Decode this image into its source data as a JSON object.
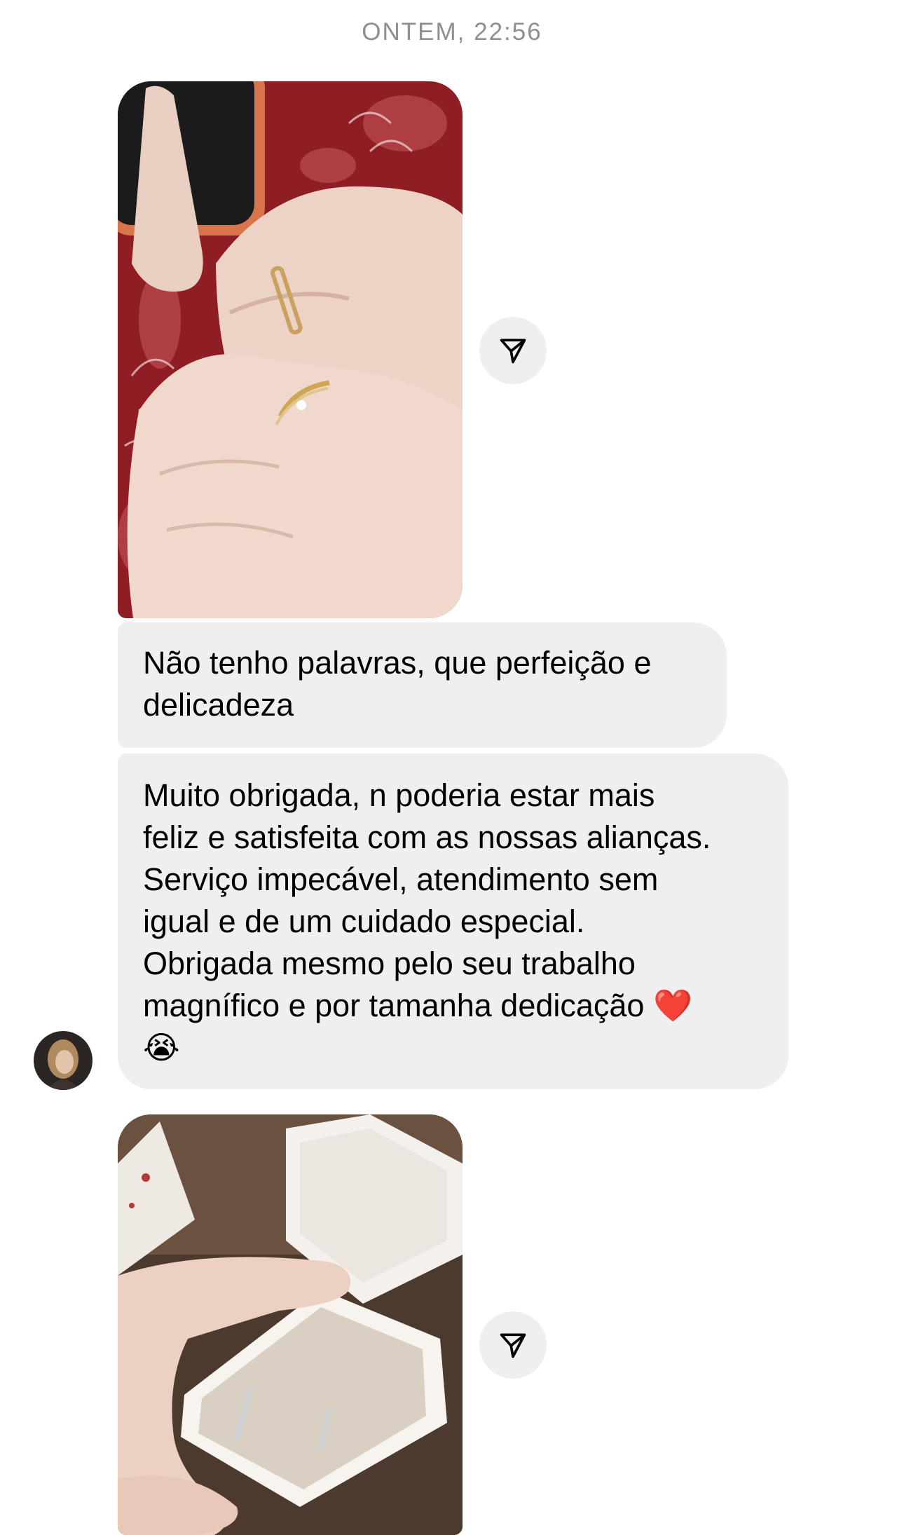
{
  "conversation": {
    "timestamp": "ONTEM, 22:56",
    "messages": [
      {
        "type": "image",
        "icon": "rings-on-hands-photo"
      },
      {
        "type": "text",
        "text": "Não tenho palavras, que perfeição e\ndelicadeza"
      },
      {
        "type": "text",
        "text": "Muito obrigada, n poderia estar mais\nfeliz e satisfeita com as nossas alianças.\nServiço impecável, atendimento sem\nigual e de um cuidado especial.\nObrigada mesmo pelo seu trabalho\nmagnífico e por tamanha dedicação ❤️\n😭"
      },
      {
        "type": "image",
        "icon": "rings-in-box-photo"
      }
    ]
  },
  "icons": {
    "share": "paper-plane-icon",
    "avatar": "user-avatar"
  },
  "colors": {
    "bubble_bg": "#efefef",
    "timestamp": "#8e8e93",
    "background": "#ffffff"
  }
}
